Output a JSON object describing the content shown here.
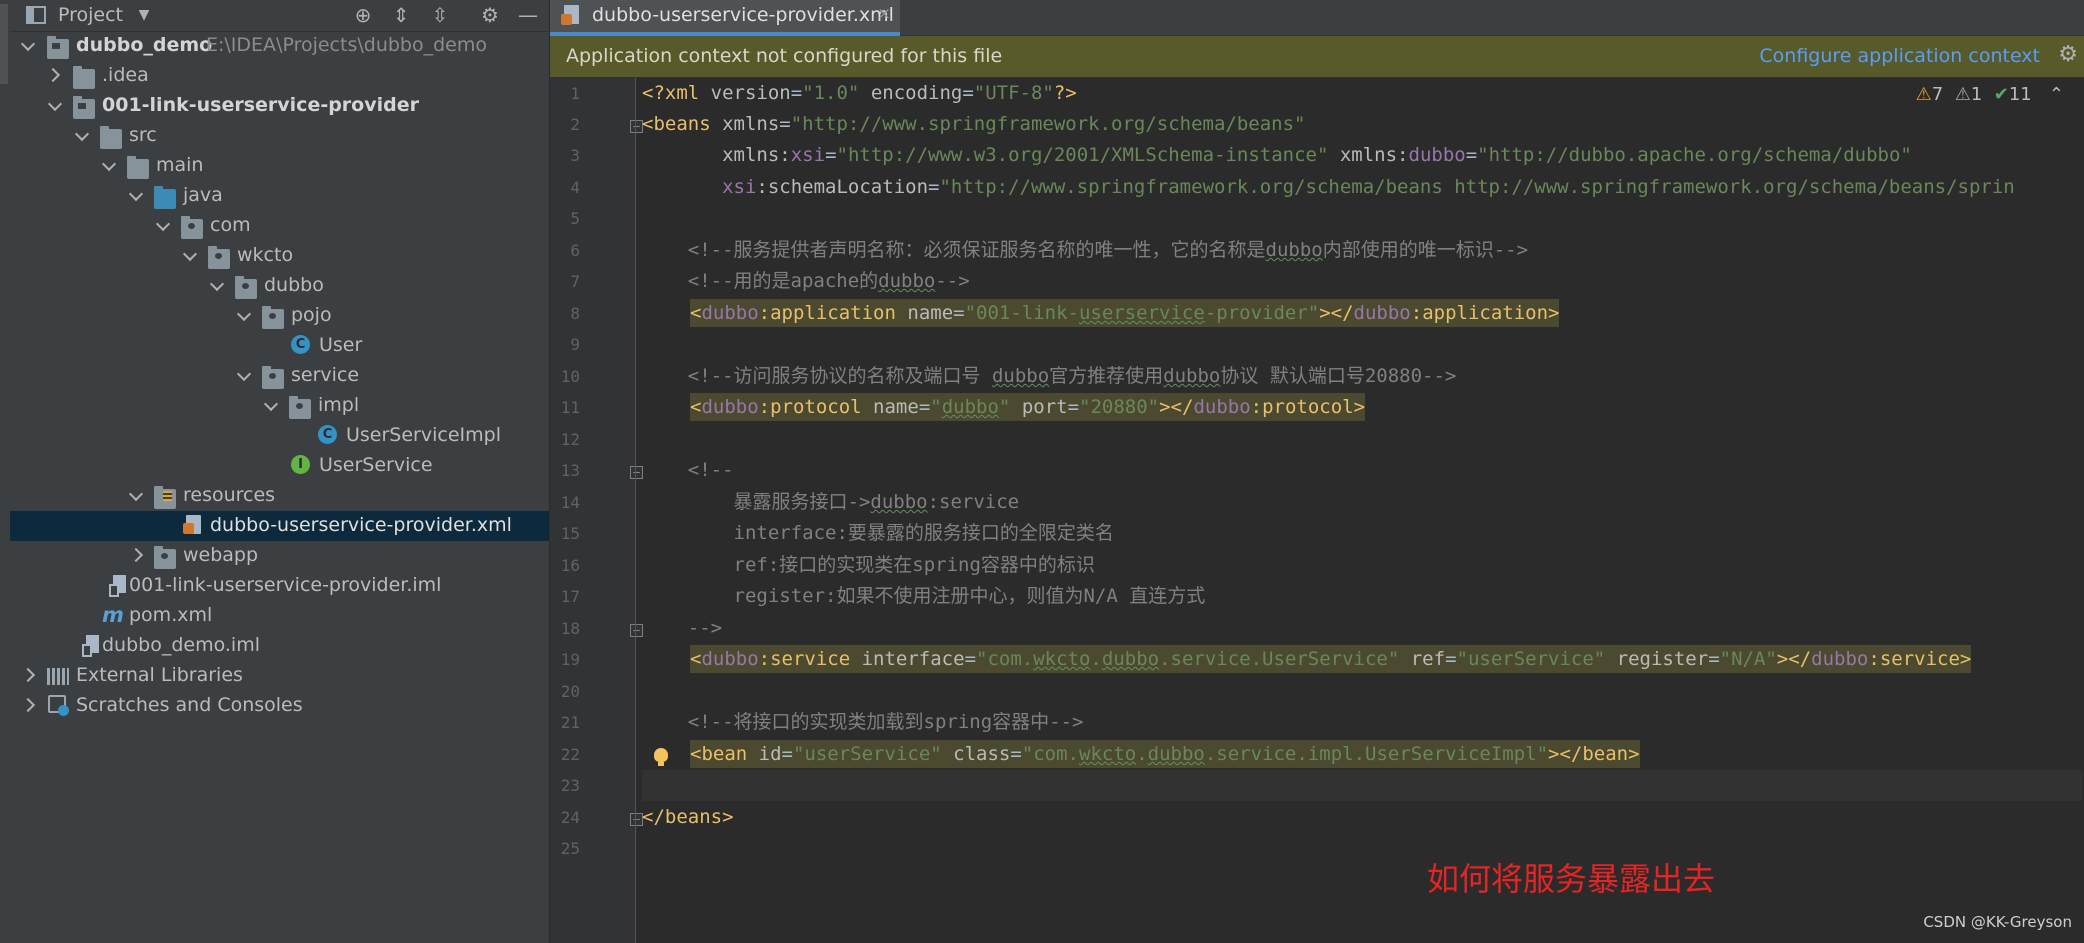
{
  "project_panel": {
    "title": "Project",
    "toolbar_icons": [
      "locate-icon",
      "expand-all-icon",
      "collapse-all-icon",
      "gear-icon",
      "hide-icon"
    ]
  },
  "tree": [
    {
      "label": "dubbo_demo",
      "path": "E:\\IDEA\\Projects\\dubbo_demo",
      "icon": "module-folder-icon"
    },
    {
      "label": ".idea",
      "icon": "folder-icon"
    },
    {
      "label": "001-link-userservice-provider",
      "icon": "module-folder-icon"
    },
    {
      "label": "src",
      "icon": "folder-icon"
    },
    {
      "label": "main",
      "icon": "folder-icon"
    },
    {
      "label": "java",
      "icon": "source-folder-icon"
    },
    {
      "label": "com",
      "icon": "package-icon"
    },
    {
      "label": "wkcto",
      "icon": "package-icon"
    },
    {
      "label": "dubbo",
      "icon": "package-icon"
    },
    {
      "label": "pojo",
      "icon": "package-icon"
    },
    {
      "label": "User",
      "icon": "class-icon"
    },
    {
      "label": "service",
      "icon": "package-icon"
    },
    {
      "label": "impl",
      "icon": "package-icon"
    },
    {
      "label": "UserServiceImpl",
      "icon": "class-icon"
    },
    {
      "label": "UserService",
      "icon": "interface-icon"
    },
    {
      "label": "resources",
      "icon": "resources-folder-icon"
    },
    {
      "label": "dubbo-userservice-provider.xml",
      "icon": "xml-file-icon"
    },
    {
      "label": "webapp",
      "icon": "web-folder-icon"
    },
    {
      "label": "001-link-userservice-provider.iml",
      "icon": "iml-file-icon"
    },
    {
      "label": "pom.xml",
      "icon": "maven-icon"
    },
    {
      "label": "dubbo_demo.iml",
      "icon": "iml-file-icon"
    },
    {
      "label": "External Libraries",
      "icon": "libraries-icon"
    },
    {
      "label": "Scratches and Consoles",
      "icon": "scratches-icon"
    }
  ],
  "editor": {
    "tab": {
      "label": "dubbo-userservice-provider.xml",
      "close": "×"
    },
    "banner": {
      "message": "Application context not configured for this file",
      "action": "Configure application context"
    },
    "inspections": {
      "warnings": "7",
      "weak_warnings": "1",
      "typos": "11"
    },
    "line_numbers": [
      "1",
      "2",
      "3",
      "4",
      "5",
      "6",
      "7",
      "8",
      "9",
      "10",
      "11",
      "12",
      "13",
      "14",
      "15",
      "16",
      "17",
      "18",
      "19",
      "20",
      "21",
      "22",
      "23",
      "24",
      "25"
    ],
    "code": {
      "l1_a": "<?xml ",
      "l1_b": "version",
      "l1_c": "=",
      "l1_d": "\"1.0\"",
      "l1_e": " encoding",
      "l1_f": "=",
      "l1_g": "\"UTF-8\"",
      "l1_h": "?>",
      "l2_a": "<beans ",
      "l2_b": "xmlns",
      "l2_c": "=",
      "l2_d": "\"http://www.springframework.org/schema/beans\"",
      "l3_a": "       xmlns",
      "l3_b": ":",
      "l3_c": "xsi",
      "l3_d": "=",
      "l3_e": "\"http://www.w3.org/2001/XMLSchema-instance\"",
      "l3_f": " xmlns",
      "l3_g": ":",
      "l3_h": "dubbo",
      "l3_i": "=",
      "l3_j": "\"http://dubbo.apache.org/schema/dubbo\"",
      "l4_a": "       ",
      "l4_b": "xsi",
      "l4_c": ":",
      "l4_d": "schemaLocation",
      "l4_e": "=",
      "l4_f": "\"http://www.springframework.org/schema/beans http://www.springframework.org/schema/beans/sprin",
      "l6_a": "    <!--服务提供者声明名称：必须保证服务名称的唯一性，它的名称是",
      "l6_b": "dubbo",
      "l6_c": "内部使用的唯一标识-->",
      "l7_a": "    <!--用的是apache的",
      "l7_b": "dubbo",
      "l7_c": "-->",
      "l8_a": "<",
      "l8_b": "dubbo",
      "l8_c": ":application ",
      "l8_d": "name",
      "l8_e": "=",
      "l8_f": "\"001-link-",
      "l8_g": "userservice",
      "l8_h": "-provider\"",
      "l8_i": "></",
      "l8_j": "dubbo",
      "l8_k": ":application>",
      "l10_a": "    <!--访问服务协议的名称及端口号 ",
      "l10_b": "dubbo",
      "l10_c": "官方推荐使用",
      "l10_d": "dubbo",
      "l10_e": "协议 默认端口号20880-->",
      "l11_a": "<",
      "l11_b": "dubbo",
      "l11_c": ":protocol ",
      "l11_d": "name",
      "l11_e": "=",
      "l11_f": "\"",
      "l11_g": "dubbo",
      "l11_h": "\"",
      "l11_i": " port",
      "l11_j": "=",
      "l11_k": "\"20880\"",
      "l11_l": "></",
      "l11_m": "dubbo",
      "l11_n": ":protocol>",
      "l13": "    <!--",
      "l14_a": "        暴露服务接口->",
      "l14_b": "dubbo",
      "l14_c": ":service",
      "l15": "        interface:要暴露的服务接口的全限定类名",
      "l16": "        ref:接口的实现类在spring容器中的标识",
      "l17": "        register:如果不使用注册中心，则值为N/A 直连方式",
      "l18": "    -->",
      "l19_a": "<",
      "l19_b": "dubbo",
      "l19_c": ":service ",
      "l19_d": "interface",
      "l19_e": "=",
      "l19_f": "\"com.",
      "l19_g": "wkcto",
      "l19_h": ".",
      "l19_i": "dubbo",
      "l19_j": ".service.UserService\"",
      "l19_k": " ref",
      "l19_l": "=",
      "l19_m": "\"userService\"",
      "l19_n": " register",
      "l19_o": "=",
      "l19_p": "\"N/A\"",
      "l19_q": "></",
      "l19_r": "dubbo",
      "l19_s": ":service>",
      "l21": "    <!--将接口的实现类加载到spring容器中-->",
      "l22_a": "<bean ",
      "l22_b": "id",
      "l22_c": "=",
      "l22_d": "\"userService\"",
      "l22_e": " class",
      "l22_f": "=",
      "l22_g": "\"com.",
      "l22_h": "wkcto",
      "l22_i": ".",
      "l22_j": "dubbo",
      "l22_k": ".service.impl.UserServiceImpl\"",
      "l22_l": "></bean>",
      "l24": "</beans>"
    }
  },
  "annotation": "如何将服务暴露出去",
  "watermark": "CSDN @KK-Greyson",
  "colors": {
    "tag": "#e8bf6a",
    "attr_value": "#6a8759",
    "namespace": "#9876aa",
    "comment": "#808080",
    "selection": "#0d293e",
    "banner": "#585a2a",
    "annotation": "#e52424"
  }
}
